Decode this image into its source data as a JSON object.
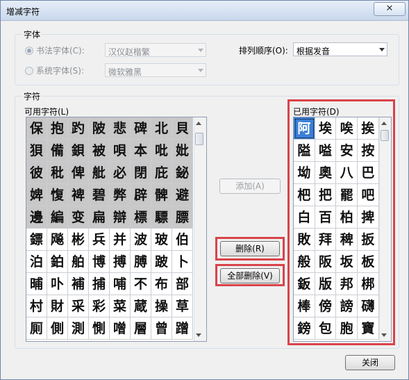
{
  "window": {
    "title": "增减字符",
    "close_glyph": "✕"
  },
  "font_group": {
    "label": "字体",
    "calligraphy": {
      "label": "书法字体(C):",
      "value": "汉仪赵楷繁",
      "selected": true
    },
    "system": {
      "label": "系统字体(S):",
      "value": "微软雅黑",
      "selected": false
    },
    "sort_label": "排列顺序(O):",
    "sort_value": "根据发音"
  },
  "chars_group": {
    "label": "字符",
    "available_label": "可用字符(L)",
    "used_label": "已用字符(D)",
    "available_rows": [
      [
        "保",
        "抱",
        "趵",
        "陂",
        "悲",
        "碑",
        "北",
        "貝"
      ],
      [
        "狽",
        "備",
        "鋇",
        "被",
        "唄",
        "本",
        "吡",
        "妣"
      ],
      [
        "彼",
        "秕",
        "俾",
        "舭",
        "必",
        "閉",
        "庇",
        "鉍"
      ],
      [
        "婢",
        "愎",
        "裨",
        "碧",
        "弊",
        "辟",
        "髀",
        "避"
      ],
      [
        "邊",
        "編",
        "变",
        "扁",
        "辯",
        "標",
        "驃",
        "膘"
      ],
      [
        "鏢",
        "飚",
        "彬",
        "兵",
        "并",
        "波",
        "玻",
        "伯"
      ],
      [
        "泊",
        "鉑",
        "舶",
        "博",
        "搏",
        "膊",
        "跛",
        "卜"
      ],
      [
        "晡",
        "卟",
        "補",
        "捕",
        "哺",
        "不",
        "布",
        "部"
      ],
      [
        "村",
        "財",
        "采",
        "彩",
        "菜",
        "蔵",
        "操",
        "草"
      ],
      [
        "厠",
        "側",
        "測",
        "惻",
        "噌",
        "層",
        "曾",
        "蹭"
      ]
    ],
    "available_gray_rows": 5,
    "used_rows": [
      [
        "阿",
        "埃",
        "唉",
        "挨"
      ],
      [
        "隘",
        "嗌",
        "安",
        "按"
      ],
      [
        "坳",
        "奧",
        "八",
        "巴"
      ],
      [
        "杷",
        "把",
        "罷",
        "吧"
      ],
      [
        "白",
        "百",
        "柏",
        "捭"
      ],
      [
        "敗",
        "拜",
        "稗",
        "扳"
      ],
      [
        "般",
        "阪",
        "坂",
        "板"
      ],
      [
        "鈑",
        "版",
        "邦",
        "梆"
      ],
      [
        "棒",
        "傍",
        "謗",
        "礴"
      ],
      [
        "鎊",
        "包",
        "胞",
        "寶"
      ]
    ],
    "used_highlight": "阿"
  },
  "buttons": {
    "add": "添加(A)",
    "delete": "删除(R)",
    "delete_all": "全部删除(V)",
    "close": "关闭"
  }
}
